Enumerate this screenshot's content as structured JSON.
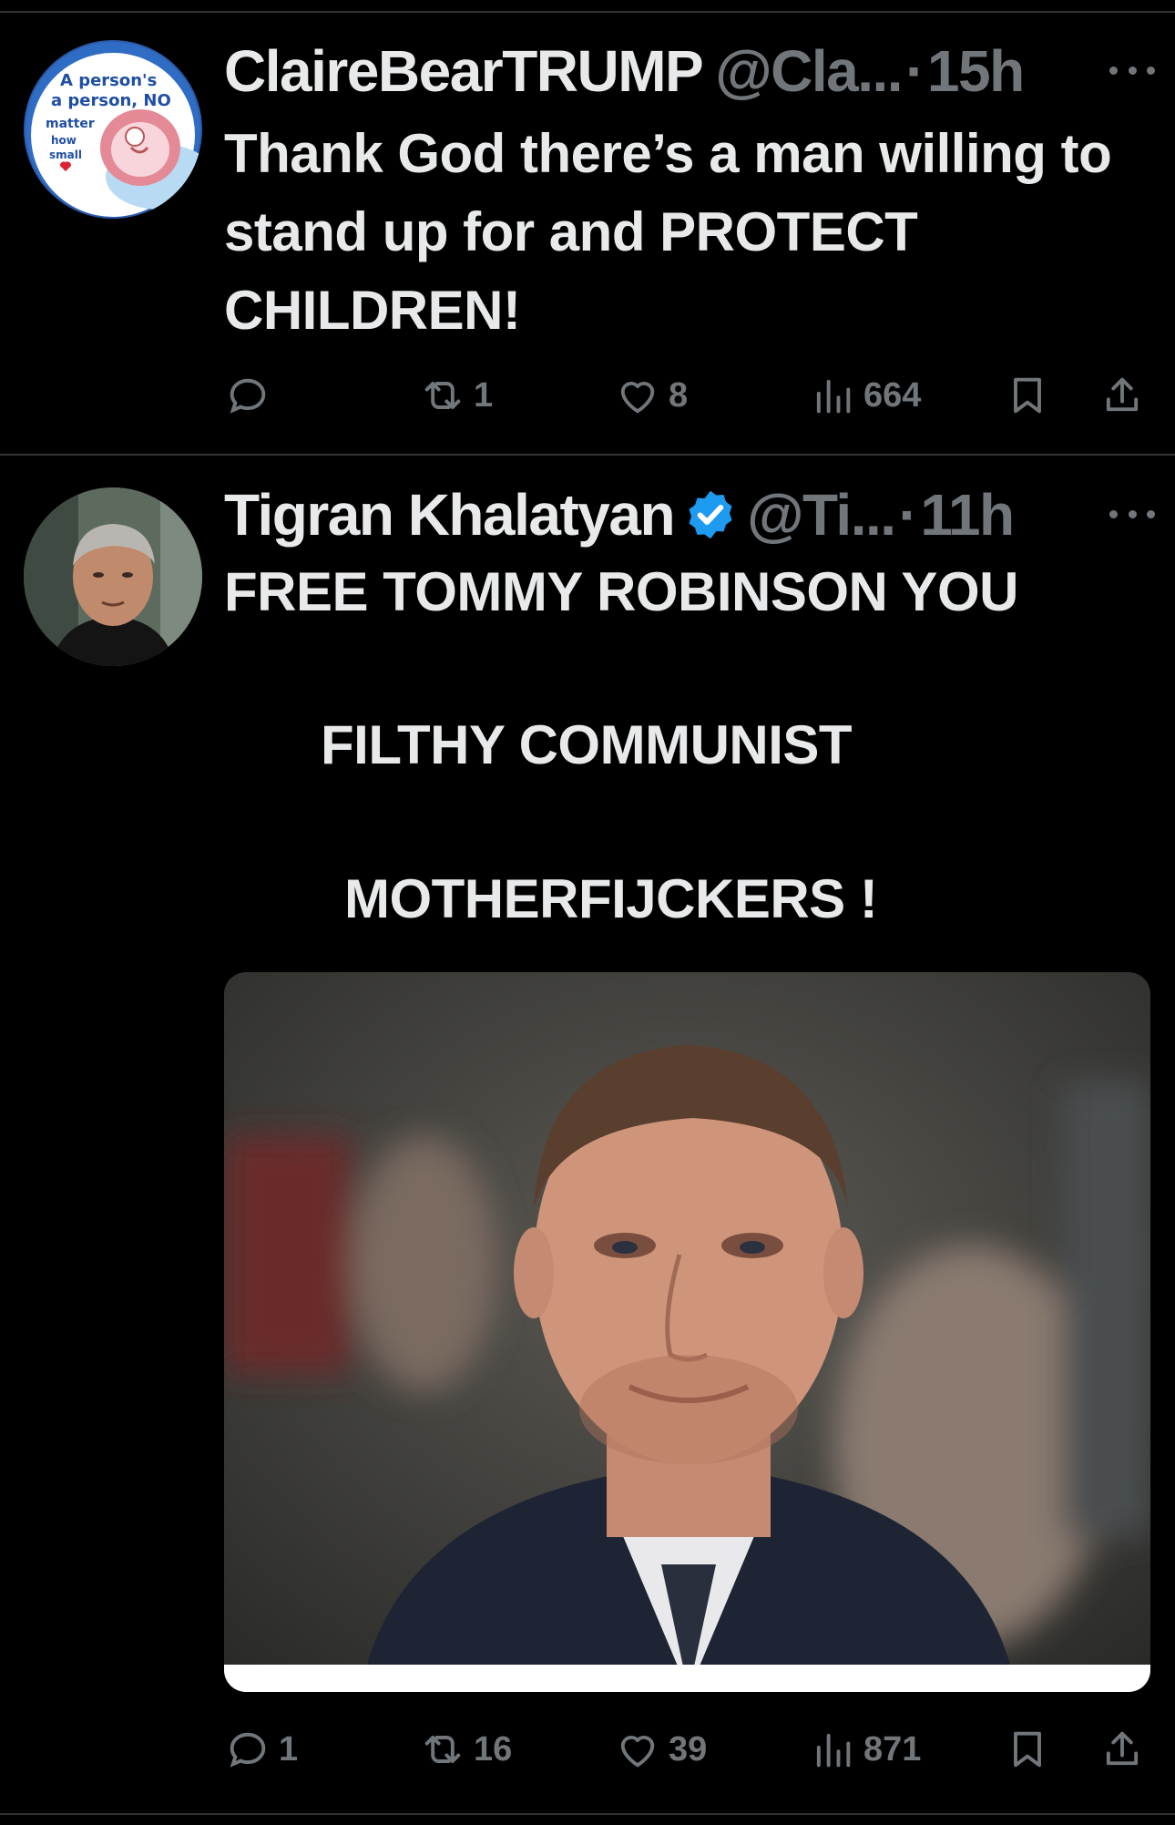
{
  "tweets": [
    {
      "name": "ClaireBearTRUMP",
      "handle": "@Cla...",
      "dot": "·",
      "time": "15h",
      "verified": false,
      "avatar_text": [
        "A person's",
        "a person, NO",
        "matter",
        "how",
        "small"
      ],
      "text": "Thank God there’s a man willing to stand up for and PROTECT CHILDREN!",
      "actions": {
        "replies": "",
        "retweets": "1",
        "likes": "8",
        "views": "664"
      }
    },
    {
      "name": "Tigran Khalatyan",
      "handle": "@Ti...",
      "dot": "·",
      "time": "11h",
      "verified": true,
      "text_line1": "FREE TOMMY ROBINSON YOU",
      "text_line2": "FILTHY COMMUNIST",
      "text_line3": "MOTHERFIJCKERS !",
      "actions": {
        "replies": "1",
        "retweets": "16",
        "likes": "39",
        "views": "871"
      }
    }
  ],
  "icons": {
    "reply": "reply-icon",
    "retweet": "retweet-icon",
    "like": "heart-icon",
    "views": "views-icon",
    "bookmark": "bookmark-icon",
    "share": "share-icon"
  },
  "colors": {
    "background": "#000000",
    "text": "#e7e9ea",
    "muted": "#71767b",
    "verified": "#1d9bf0",
    "divider": "#2f3336"
  }
}
